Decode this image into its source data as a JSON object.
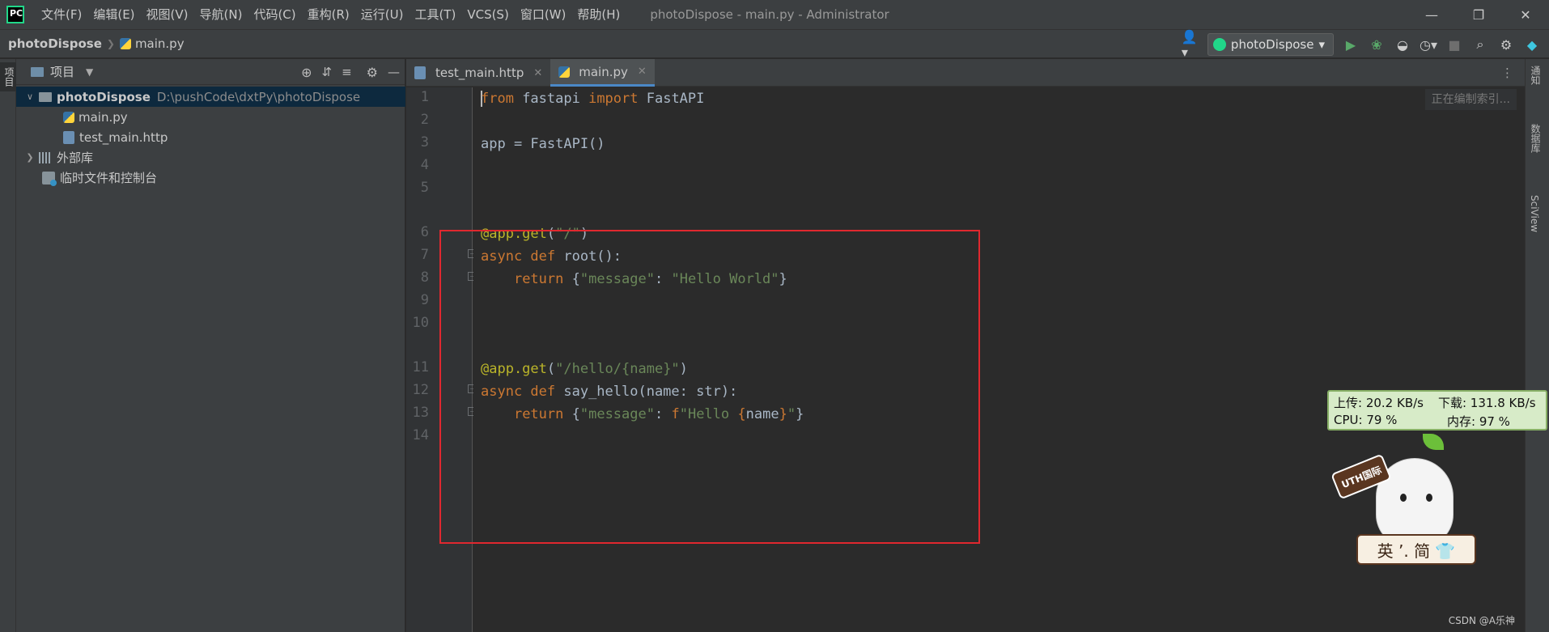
{
  "menu": [
    "文件(F)",
    "编辑(E)",
    "视图(V)",
    "导航(N)",
    "代码(C)",
    "重构(R)",
    "运行(U)",
    "工具(T)",
    "VCS(S)",
    "窗口(W)",
    "帮助(H)"
  ],
  "window_title": "photoDispose - main.py - Administrator",
  "breadcrumb": {
    "project": "photoDispose",
    "file": "main.py"
  },
  "run_config": "photoDispose",
  "left_strip_tab": "项目",
  "project_panel": {
    "title": "项目",
    "root": {
      "name": "photoDispose",
      "path": "D:\\pushCode\\dxtPy\\photoDispose"
    },
    "files": [
      "main.py",
      "test_main.http"
    ],
    "external_libs": "外部库",
    "scratches": "临时文件和控制台"
  },
  "tabs": [
    {
      "label": "test_main.http",
      "active": false
    },
    {
      "label": "main.py",
      "active": true
    }
  ],
  "editor": {
    "indexing_status": "正在编制索引...",
    "line_numbers": [
      "1",
      "2",
      "3",
      "4",
      "5",
      "6",
      "7",
      "8",
      "9",
      "10",
      "11",
      "12",
      "13",
      "14"
    ]
  },
  "right_strip": [
    "通知",
    "数据库",
    "SciView"
  ],
  "netmon": {
    "upload": "上传: 20.2 KB/s",
    "download": "下载: 131.8 KB/s",
    "cpu": "CPU: 79 %",
    "memory": "内存: 97 %"
  },
  "mascot": {
    "sign": "UTH国际",
    "plate": "英 ’. 简 👕"
  },
  "watermark": "CSDN @A乐神",
  "colors": {
    "highlight_box": "#e0282f",
    "keyword": "#cc7832",
    "string": "#6a8759",
    "decorator": "#bbb529",
    "accent": "#4a88c7"
  }
}
